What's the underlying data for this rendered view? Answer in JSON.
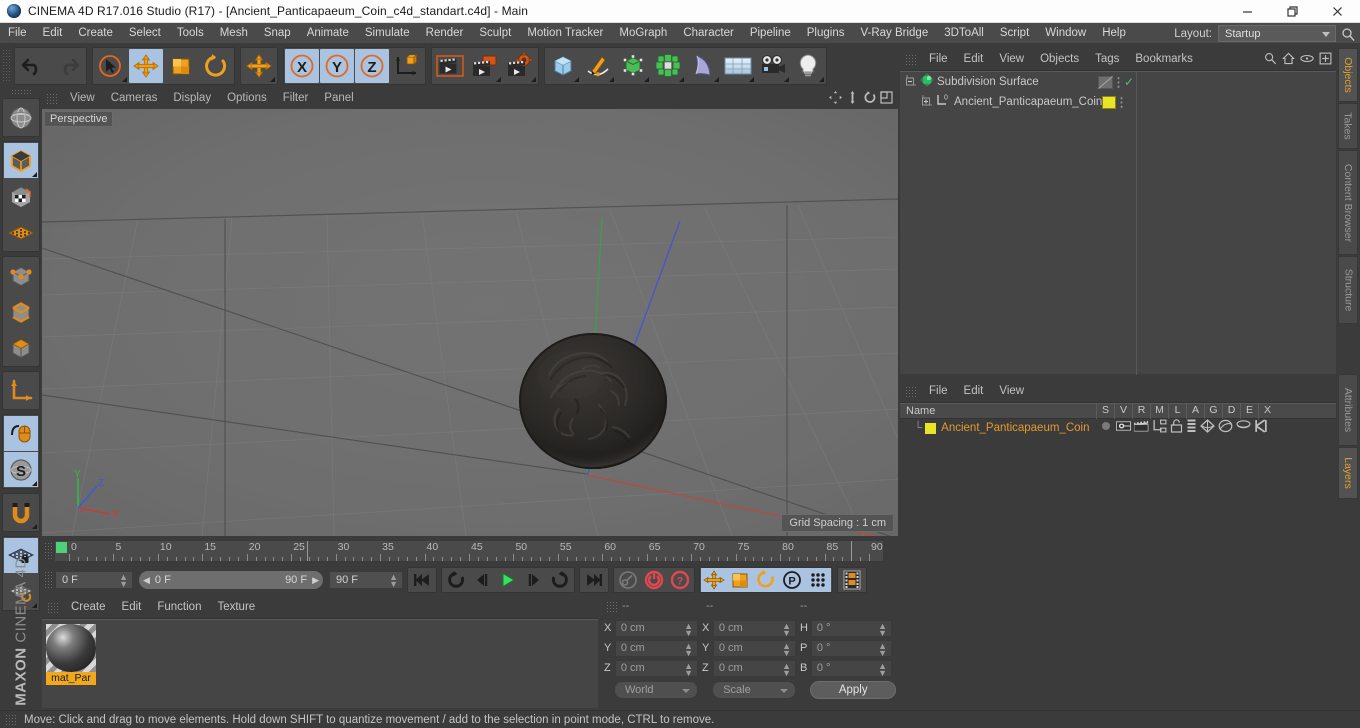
{
  "window": {
    "title": "CINEMA 4D R17.016 Studio (R17) - [Ancient_Panticapaeum_Coin_c4d_standart.c4d] - Main",
    "minimize": "—",
    "maximize": "❐",
    "close": "✕",
    "logo_icon": "cinema4d-logo-icon"
  },
  "menubar": {
    "items": [
      "File",
      "Edit",
      "Create",
      "Select",
      "Tools",
      "Mesh",
      "Snap",
      "Animate",
      "Simulate",
      "Render",
      "Sculpt",
      "Motion Tracker",
      "MoGraph",
      "Character",
      "Pipeline",
      "Plugins",
      "V-Ray Bridge",
      "3DToAll",
      "Script",
      "Window",
      "Help"
    ],
    "layout_label": "Layout:",
    "layout_value": "Startup",
    "search_icon": "search-icon"
  },
  "toolbar": {
    "groups": [
      {
        "name": "history",
        "buttons": [
          {
            "name": "undo-button",
            "icon": "undo-arrow-icon",
            "state": "normal"
          },
          {
            "name": "redo-button",
            "icon": "redo-arrow-icon",
            "state": "disabled"
          }
        ]
      },
      {
        "name": "transform-tools",
        "buttons": [
          {
            "name": "live-selection-tool",
            "icon": "cursor-selection-icon",
            "state": "normal"
          },
          {
            "name": "move-tool",
            "icon": "move-arrows-icon",
            "state": "active"
          },
          {
            "name": "scale-tool",
            "icon": "scale-box-icon",
            "state": "normal"
          },
          {
            "name": "rotate-tool",
            "icon": "rotate-circle-icon",
            "state": "normal"
          }
        ]
      },
      {
        "name": "move-mode",
        "buttons": [
          {
            "name": "move-mode-button",
            "icon": "move-arrows-icon",
            "state": "normal"
          }
        ]
      },
      {
        "name": "axis-locks",
        "buttons": [
          {
            "name": "lock-x-button",
            "icon": "axis-x-icon",
            "state": "active"
          },
          {
            "name": "lock-y-button",
            "icon": "axis-y-icon",
            "state": "active"
          },
          {
            "name": "lock-z-button",
            "icon": "axis-z-icon",
            "state": "active"
          },
          {
            "name": "world-coordinate-button",
            "icon": "world-axis-cube-icon",
            "state": "normal"
          }
        ]
      },
      {
        "name": "render-tools",
        "buttons": [
          {
            "name": "render-view-button",
            "icon": "clapperboard-icon",
            "state": "normal"
          },
          {
            "name": "render-to-picture-viewer-button",
            "icon": "clapperboard-screen-icon",
            "state": "normal"
          },
          {
            "name": "render-settings-button",
            "icon": "clapperboard-gear-icon",
            "state": "normal"
          }
        ]
      },
      {
        "name": "create-objects",
        "buttons": [
          {
            "name": "add-cube-button",
            "icon": "blue-cube-icon",
            "state": "normal"
          },
          {
            "name": "add-spline-button",
            "icon": "pen-spline-icon",
            "state": "normal"
          },
          {
            "name": "add-nurbs-button",
            "icon": "green-cube-nurbs-icon",
            "state": "normal"
          },
          {
            "name": "add-array-button",
            "icon": "green-cluster-icon",
            "state": "normal"
          },
          {
            "name": "add-deformer-button",
            "icon": "bend-deformer-icon",
            "state": "normal"
          },
          {
            "name": "add-environment-button",
            "icon": "floor-grid-icon",
            "state": "normal"
          },
          {
            "name": "add-camera-button",
            "icon": "camera-icon",
            "state": "normal"
          },
          {
            "name": "add-light-button",
            "icon": "light-bulb-icon",
            "state": "normal"
          }
        ]
      }
    ]
  },
  "left_palette": {
    "groups": [
      {
        "buttons": [
          {
            "name": "undo-view-button",
            "icon": "globe-sphere-icon",
            "state": "normal"
          }
        ]
      },
      {
        "buttons": [
          {
            "name": "model-mode-button",
            "icon": "model-cube-icon",
            "state": "active"
          },
          {
            "name": "texture-mode-button",
            "icon": "texture-checker-cube-icon",
            "state": "normal"
          },
          {
            "name": "points-grid-button",
            "icon": "orange-grid-plane-icon",
            "state": "normal"
          }
        ]
      },
      {
        "buttons": [
          {
            "name": "points-mode-button",
            "icon": "points-cube-icon",
            "state": "normal"
          },
          {
            "name": "edges-mode-button",
            "icon": "edges-cube-icon",
            "state": "normal"
          },
          {
            "name": "polygons-mode-button",
            "icon": "polygon-cube-icon",
            "state": "normal"
          }
        ]
      },
      {
        "buttons": [
          {
            "name": "axis-mode-button",
            "icon": "axis-corner-icon",
            "state": "normal"
          }
        ]
      },
      {
        "buttons": [
          {
            "name": "enable-axis-button",
            "icon": "mouse-axis-icon",
            "state": "active"
          },
          {
            "name": "soft-selection-button",
            "icon": "s-circle-icon",
            "state": "active"
          }
        ]
      },
      {
        "buttons": [
          {
            "name": "snap-button",
            "icon": "magnet-icon",
            "state": "normal"
          }
        ]
      },
      {
        "buttons": [
          {
            "name": "workplane-lock-button",
            "icon": "grid-lock-icon",
            "state": "active"
          },
          {
            "name": "workplane-rotate-button",
            "icon": "grid-rotate-icon",
            "state": "normal"
          }
        ]
      }
    ],
    "brand_bold": "MAXON",
    "brand_light": "CINEMA 4D"
  },
  "viewport": {
    "menu": [
      "View",
      "Cameras",
      "Display",
      "Options",
      "Filter",
      "Panel"
    ],
    "view_label": "Perspective",
    "grid_spacing": "Grid Spacing : 1 cm",
    "corner_icons": [
      {
        "name": "viewport-move-icon"
      },
      {
        "name": "viewport-zoom-icon"
      },
      {
        "name": "viewport-rotate-icon"
      },
      {
        "name": "viewport-maximize-icon"
      }
    ],
    "axis_labels": {
      "x": "X",
      "y": "Y",
      "z": "Z"
    },
    "axis_colors": {
      "x": "#cc3333",
      "y": "#33bb44",
      "z": "#4455dd"
    },
    "background_color": "#6e6e6e",
    "object_color": "#2b2927"
  },
  "object_manager": {
    "menu": [
      "File",
      "Edit",
      "View",
      "Objects",
      "Tags",
      "Bookmarks"
    ],
    "header_icons": [
      "search-icon",
      "home-icon",
      "eye-icon",
      "fit-icon"
    ],
    "rows": [
      {
        "name": "Subdivision Surface",
        "icon": "subdivision-surface-icon",
        "indent": 0,
        "expander": "minus",
        "tag_color": "#6f6f6f",
        "check": "✓"
      },
      {
        "name": "Ancient_Panticapaeum_Coin",
        "icon": "polygon-object-icon",
        "indent": 1,
        "expander": "plus",
        "tag_color": "#e9e427",
        "check": ""
      }
    ]
  },
  "layers_manager": {
    "menu": [
      "File",
      "Edit",
      "View"
    ],
    "columns": [
      "Name",
      "S",
      "V",
      "R",
      "M",
      "L",
      "A",
      "G",
      "D",
      "E",
      "X"
    ],
    "rows": [
      {
        "name": "Ancient_Panticapaeum_Coin",
        "color": "#e9e427",
        "icons": [
          "solo-dot-icon",
          "eye-visible-icon",
          "render-clapper-icon",
          "manager-tree-icon",
          "lock-open-icon",
          "animation-bars-icon",
          "generator-icon",
          "deformer-icon",
          "expression-icon",
          "xref-icon"
        ]
      }
    ]
  },
  "vertical_tabs": [
    {
      "label": "Objects",
      "selected": true
    },
    {
      "label": "Takes",
      "selected": false
    },
    {
      "label": "Content Browser",
      "selected": false
    },
    {
      "label": "Structure",
      "selected": false
    },
    {
      "label": "Attributes",
      "selected": false
    },
    {
      "label": "Layers",
      "selected": true
    }
  ],
  "timeline": {
    "ticks": [
      0,
      5,
      10,
      15,
      20,
      25,
      30,
      35,
      40,
      45,
      50,
      55,
      60,
      65,
      70,
      75,
      80,
      85,
      90
    ],
    "start": 0,
    "end": 90,
    "current_frame_marker": 0
  },
  "transport": {
    "current_frame": "0 F",
    "range_start": "0 F",
    "range_end": "90 F",
    "max_frame": "90 F",
    "end_frame_field": "0 F",
    "buttons": [
      {
        "name": "go-to-start-button",
        "icon": "skip-back-icon",
        "state": "normal"
      },
      {
        "name": "play-reverse-rewind-button",
        "icon": "loop-icon",
        "state": "normal"
      },
      {
        "name": "step-back-button",
        "icon": "step-back-icon",
        "state": "normal"
      },
      {
        "name": "play-button",
        "icon": "play-icon",
        "state": "normal"
      },
      {
        "name": "step-forward-button",
        "icon": "step-forward-icon",
        "state": "normal"
      },
      {
        "name": "play-forward-button",
        "icon": "loop-forward-icon",
        "state": "normal"
      },
      {
        "name": "go-to-end-button",
        "icon": "skip-forward-icon",
        "state": "normal"
      },
      {
        "name": "autokey-button",
        "icon": "key-icon",
        "state": "disabled"
      },
      {
        "name": "record-button",
        "icon": "record-circle-icon",
        "state": "normal"
      },
      {
        "name": "autokeying-button",
        "icon": "record-question-icon",
        "state": "normal"
      },
      {
        "name": "key-position-button",
        "icon": "move-arrows-icon",
        "state": "active"
      },
      {
        "name": "key-scale-button",
        "icon": "scale-box-icon",
        "state": "active"
      },
      {
        "name": "key-rotation-button",
        "icon": "rotate-circle-icon",
        "state": "active"
      },
      {
        "name": "key-parameter-button",
        "icon": "p-circle-icon",
        "state": "active"
      },
      {
        "name": "key-pla-button",
        "icon": "dots-grid-icon",
        "state": "active"
      },
      {
        "name": "keyframe-selection-button",
        "icon": "filmstrip-icon",
        "state": "normal"
      }
    ]
  },
  "material_manager": {
    "menu": [
      "Create",
      "Edit",
      "Function",
      "Texture"
    ],
    "materials": [
      {
        "name": "mat_Par",
        "label_bg": "#f0a81e"
      }
    ]
  },
  "coordinates_manager": {
    "header_placeholders": [
      "--",
      "--",
      "--"
    ],
    "position": {
      "label_x": "X",
      "label_y": "Y",
      "label_z": "Z",
      "x": "0 cm",
      "y": "0 cm",
      "z": "0 cm"
    },
    "size": {
      "label_x": "X",
      "label_y": "Y",
      "label_z": "Z",
      "x": "0 cm",
      "y": "0 cm",
      "z": "0 cm"
    },
    "rotation": {
      "label_h": "H",
      "label_p": "P",
      "label_b": "B",
      "h": "0 °",
      "p": "0 °",
      "b": "0 °"
    },
    "coord_system": "World",
    "transform_mode": "Scale",
    "apply_label": "Apply"
  },
  "status_bar": {
    "text": "Move: Click and drag to move elements. Hold down SHIFT to quantize movement / add to the selection in point mode, CTRL to remove."
  }
}
